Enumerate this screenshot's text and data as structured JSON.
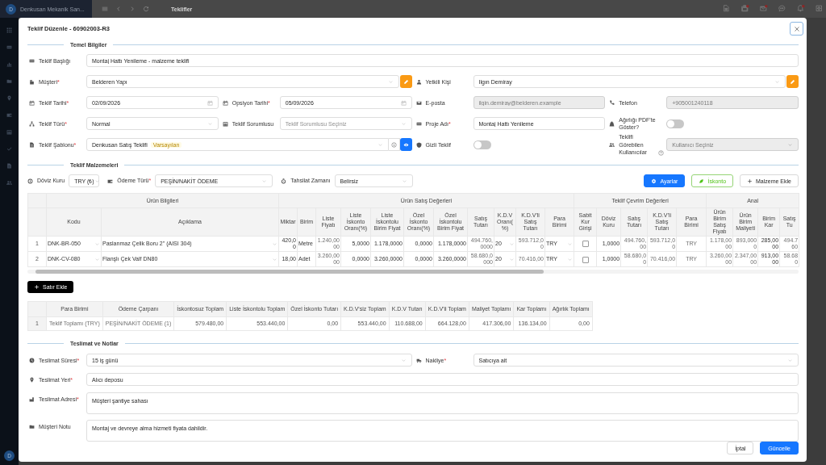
{
  "app_bar": {
    "avatar": "D",
    "company": "Denkusan Mekanik San...",
    "page_title": "Teklifler"
  },
  "sidebar": {
    "avatar": "D"
  },
  "modal": {
    "title": "Teklif Düzenle - 60902003-R3"
  },
  "basic": {
    "heading": "Temel Bilgiler",
    "fields": [
      {
        "kind": "text",
        "label": "Teklif Başlığı",
        "value": "Montaj Hattı Yenileme - malzeme teklifi",
        "disabled": false
      },
      {
        "kind": "select_edit",
        "label": "Müşteri",
        "required_mark": "*",
        "value": "Belderen Yapı",
        "disabled": false
      },
      {
        "kind": "select_edit",
        "label": "Yetkili Kişi",
        "value": "Ilgın Demiray",
        "disabled": false
      },
      {
        "kind": "date",
        "label": "Teklif Tarihi",
        "required_mark": "*",
        "value": "02/09/2026",
        "disabled": false
      },
      {
        "kind": "date",
        "label": "Opsiyon Tarihi",
        "required_mark": "*",
        "value": "05/09/2026",
        "disabled": false
      },
      {
        "kind": "text",
        "label": "E-posta",
        "value": "ilgin.demiray@belderen.example",
        "disabled": true
      },
      {
        "kind": "text",
        "label": "Telefon",
        "value": "+905001240118",
        "disabled": true
      },
      {
        "kind": "select",
        "label": "Teklif Türü",
        "required_mark": "*",
        "value": "Normal",
        "disabled": false
      },
      {
        "kind": "select",
        "label": "Teklif Sorumlusu",
        "placeholder": "Teklif Sorumlusu Seçiniz",
        "disabled": false
      },
      {
        "kind": "text",
        "label": "Proje Adı",
        "required_mark": "*",
        "value": "Montaj Hattı Yenileme",
        "disabled": false
      },
      {
        "kind": "toggle",
        "label": "Ağırlığı PDF'te Göster?",
        "on": false
      },
      {
        "kind": "template",
        "label": "Teklif Şablonu",
        "required_mark": "*",
        "value": "Denkusan Satış Teklifi",
        "tag": "Varsayılan",
        "disabled": false
      },
      {
        "kind": "toggle",
        "label": "Gizli Teklif",
        "on": false
      },
      {
        "kind": "select",
        "label": "Teklifi Görebilen Kullanıcılar",
        "placeholder": "Kullanıcı Seçiniz",
        "disabled": true
      }
    ]
  },
  "materials": {
    "heading": "Teklif Malzemeleri",
    "filters": [
      {
        "label": "Döviz Kuru",
        "value": "TRY (₺)"
      },
      {
        "label": "Ödeme Türü",
        "required_mark": "*",
        "value": "PEŞİN/NAKİT ÖDEME"
      },
      {
        "label": "Tahsilat Zamanı",
        "value": "Belirsiz"
      }
    ],
    "actions": [
      {
        "kind": "primary",
        "label": "Ayarlar"
      },
      {
        "kind": "success",
        "label": "İskonto"
      },
      {
        "kind": "default",
        "label": "Malzeme Ekle"
      }
    ],
    "table": {
      "groups": [
        {
          "label": "Ürün Bilgileri"
        },
        {
          "label": "Ürün Satış Değerleri"
        },
        {
          "label": "Teklif Çevrim Değerleri"
        },
        {
          "label": "Anal"
        }
      ],
      "columns": [
        {
          "kind": "index"
        },
        {
          "label": "Kodu",
          "kind": "select"
        },
        {
          "label": "Açıklama",
          "kind": "select"
        },
        {
          "label": "Miktar",
          "kind": "number"
        },
        {
          "label": "Birim",
          "kind": "text"
        },
        {
          "label": "Liste Fiyatı",
          "kind": "readonly"
        },
        {
          "label": "Liste İskonto Oranı(%)",
          "kind": "number"
        },
        {
          "label": "Liste İskontolu Birim Fiyat",
          "kind": "number"
        },
        {
          "label": "Özel İskonto Oranı(%)",
          "kind": "number"
        },
        {
          "label": "Özel İskontolu Birim Fiyat",
          "kind": "number"
        },
        {
          "label": "Satış Tutarı",
          "kind": "readonly"
        },
        {
          "label": "K.D.V Oranı(%)",
          "kind": "select"
        },
        {
          "label": "K.D.V'li Satış Tutarı",
          "kind": "readonly"
        },
        {
          "label": "Para Birimi",
          "kind": "select"
        },
        {
          "label": "Sabit Kur Girişi",
          "kind": "check"
        },
        {
          "label": "Döviz Kuru",
          "kind": "number"
        },
        {
          "label": "Satış Tutarı",
          "kind": "readonly"
        },
        {
          "label": "K.D.V'li Satış Tutarı",
          "kind": "readonly"
        },
        {
          "label": "Para Birimi",
          "kind": "code"
        },
        {
          "label": "Ürün Birim Satış Fiyatı",
          "kind": "readonly"
        },
        {
          "label": "Ürün Birim Maliyeti",
          "kind": "readonly"
        },
        {
          "label": "Birim Kar",
          "kind": "number"
        },
        {
          "label": "Satış Tu",
          "kind": "readonly"
        }
      ],
      "rows": [
        {
          "cells": [
            "1",
            "DNK-BR-050",
            "Paslanmaz Çelik Boru 2\" (AISI 304)",
            "420,00",
            "Metre",
            "1.240,0000",
            "5,0000",
            "1.178,0000",
            "0,0000",
            "1.178,0000",
            "494.760,0000",
            "20",
            "593.712,00",
            "TRY",
            false,
            "1,0000",
            "494.760,00",
            "593.712,00",
            "TRY",
            "1.178,0000",
            "893,0000",
            "285,0000",
            "494.760"
          ]
        },
        {
          "cells": [
            "2",
            "DNK-CV-080",
            "Flanşlı Çek Valf DN80",
            "18,00",
            "Adet",
            "3.260,0000",
            "0,0000",
            "3.260,0000",
            "0,0000",
            "3.260,0000",
            "58.680,0000",
            "20",
            "70.416,00",
            "TRY",
            false,
            "1,0000",
            "58.680,00",
            "70.416,00",
            "TRY",
            "3.260,0000",
            "2.347,0000",
            "913,0000",
            "58.680"
          ]
        }
      ]
    },
    "add_row": "Satır Ekle",
    "summary": {
      "columns": [
        "Para Birimi",
        "Ödeme Çarpanı",
        "İskontosuz Toplam",
        "Liste İskontolu Toplam",
        "Özel İskonto Tutarı",
        "K.D.V'siz Toplam",
        "K.D.V Tutarı",
        "K.D.V'li Toplam",
        "Maliyet Toplamı",
        "Kar Toplamı",
        "Ağırlık Toplamı"
      ],
      "rows": [
        {
          "index": "1",
          "cells": [
            "Teklif Toplamı (TRY)",
            "PEŞİN/NAKİT ÖDEME (1)",
            "579.480,00",
            "553.440,00",
            "0,00",
            "553.440,00",
            "110.688,00",
            "664.128,00",
            "417.306,00",
            "136.134,00",
            "0,00"
          ]
        }
      ]
    }
  },
  "delivery": {
    "heading": "Teslimat ve Notlar",
    "fields": [
      {
        "kind": "select",
        "label": "Teslimat Süresi",
        "required_mark": "*",
        "value": "15 iş günü"
      },
      {
        "kind": "select",
        "label": "Nakliye",
        "required_mark": "*",
        "value": "Satıcıya ait"
      },
      {
        "kind": "text",
        "label": "Teslimat Yeri",
        "required_mark": "*",
        "value": "Alıcı deposu"
      },
      {
        "kind": "textarea",
        "label": "Teslimat Adresi",
        "required_mark": "*",
        "value": "Müşteri şantiye sahası"
      },
      {
        "kind": "textarea",
        "label": "Müşteri Notu",
        "value": "Montaj ve devreye alma hizmeti fiyata dahildir."
      }
    ]
  },
  "footer": {
    "buttons": [
      {
        "kind": "default",
        "label": "İptal"
      },
      {
        "kind": "primary",
        "label": "Güncelle"
      }
    ]
  }
}
